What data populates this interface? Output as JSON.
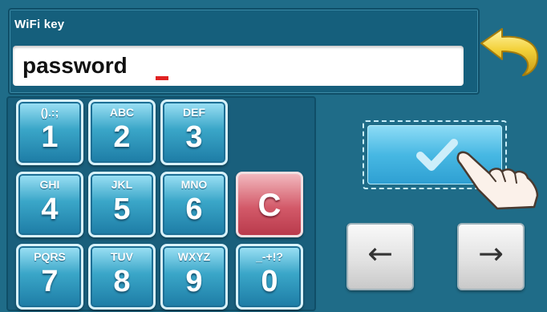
{
  "header": {
    "title": "WiFi key"
  },
  "input": {
    "value": "password",
    "caret_color": "#e02222"
  },
  "keypad": {
    "keys": [
      {
        "sub": "().:;",
        "main": "1"
      },
      {
        "sub": "ABC",
        "main": "2"
      },
      {
        "sub": "DEF",
        "main": "3"
      },
      {
        "sub": "GHI",
        "main": "4"
      },
      {
        "sub": "JKL",
        "main": "5"
      },
      {
        "sub": "MNO",
        "main": "6"
      },
      {
        "sub": "PQRS",
        "main": "7"
      },
      {
        "sub": "TUV",
        "main": "8"
      },
      {
        "sub": "WXYZ",
        "main": "9"
      },
      {
        "sub": "_-+!?",
        "main": "0"
      }
    ],
    "clear_label": "C"
  },
  "nav": {
    "left_arrow": "←",
    "right_arrow": "→"
  },
  "icons": {
    "back": "back-arrow-icon",
    "confirm": "checkmark-icon",
    "pointer": "pointing-hand-icon"
  },
  "colors": {
    "background": "#1f6c88",
    "key_blue": "#3aa6c8",
    "clear_red": "#d35a69",
    "confirm_blue": "#47b8e3",
    "back_arrow_yellow": "#f3d13a"
  }
}
